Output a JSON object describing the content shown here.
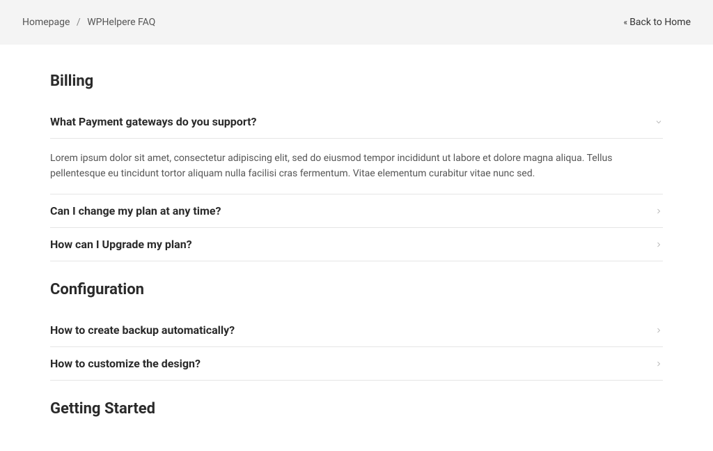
{
  "breadcrumb": {
    "home": "Homepage",
    "current": "WPHelpere FAQ"
  },
  "back_link": "Back to Home",
  "sections": [
    {
      "title": "Billing",
      "items": [
        {
          "question": "What Payment gateways do you support?",
          "expanded": true,
          "answer": "Lorem ipsum dolor sit amet, consectetur adipiscing elit, sed do eiusmod tempor incididunt ut labore et dolore magna aliqua. Tellus pellentesque eu tincidunt tortor aliquam nulla facilisi cras fermentum. Vitae elementum curabitur vitae nunc sed."
        },
        {
          "question": "Can I change my plan at any time?",
          "expanded": false
        },
        {
          "question": "How can I Upgrade my plan?",
          "expanded": false
        }
      ]
    },
    {
      "title": "Configuration",
      "items": [
        {
          "question": "How to create backup automatically?",
          "expanded": false
        },
        {
          "question": "How to customize the design?",
          "expanded": false
        }
      ]
    },
    {
      "title": "Getting Started",
      "items": []
    }
  ]
}
